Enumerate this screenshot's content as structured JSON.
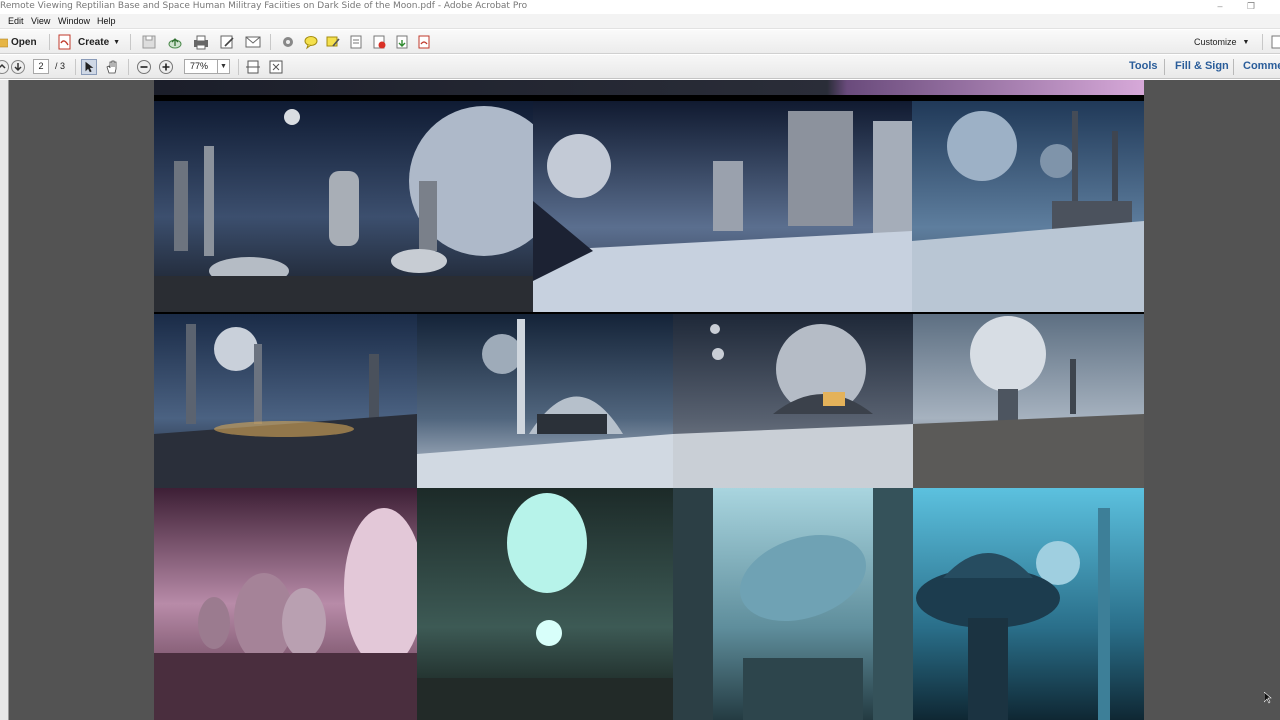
{
  "window": {
    "title": "Remote Viewing Reptilian Base and Space Human Militray Faciities on Dark Side of the Moon.pdf - Adobe Acrobat Pro"
  },
  "menu": [
    "Edit",
    "View",
    "Window",
    "Help"
  ],
  "toolbar": {
    "open_label": "Open",
    "create_label": "Create",
    "customize_label": "Customize"
  },
  "nav": {
    "page_current": "2",
    "page_total": "/ 3",
    "zoom": "77%"
  },
  "panels": {
    "tools": "Tools",
    "fill_sign": "Fill & Sign",
    "comment": "Comme"
  },
  "colors": {
    "link_blue": "#2a5d9a",
    "doc_background": "#535353"
  }
}
